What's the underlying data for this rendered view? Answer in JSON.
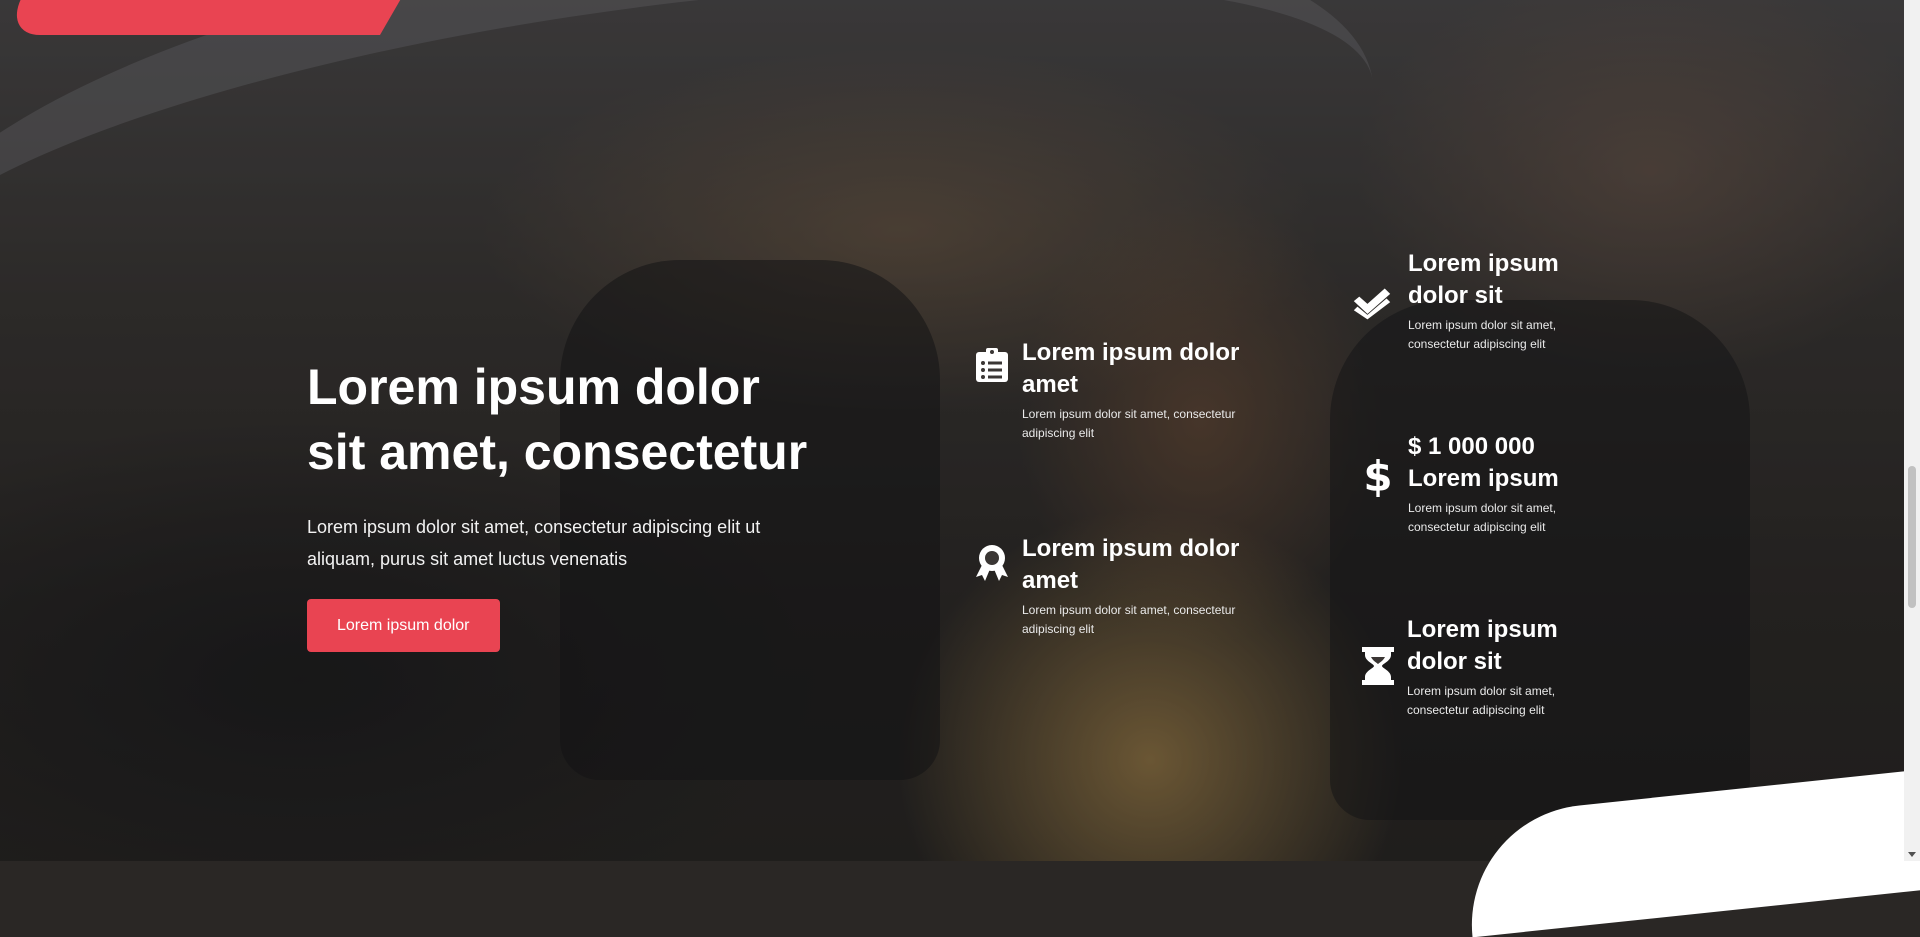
{
  "hero": {
    "title": "Lorem ipsum dolor sit amet, consectetur",
    "subtitle": "Lorem ipsum dolor sit amet, consectetur adipiscing elit ut aliquam, purus sit amet luctus venenatis",
    "cta_label": "Lorem ipsum dolor"
  },
  "features": [
    {
      "icon": "clipboard-list-icon",
      "title": "Lorem ipsum dolor amet",
      "desc": "Lorem ipsum dolor sit amet, consectetur adipiscing elit"
    },
    {
      "icon": "award-icon",
      "title": "Lorem ipsum dolor amet",
      "desc": "Lorem ipsum dolor sit amet, consectetur adipiscing elit"
    },
    {
      "icon": "double-check-icon",
      "title": "Lorem ipsum dolor sit",
      "desc": "Lorem ipsum dolor sit amet, consectetur adipiscing elit"
    },
    {
      "icon": "dollar-icon",
      "title": "$ 1 000 000 Lorem ipsum",
      "desc": "Lorem ipsum dolor sit amet, consectetur adipiscing elit"
    },
    {
      "icon": "hourglass-icon",
      "title": "Lorem ipsum dolor sit",
      "desc": "Lorem ipsum dolor sit amet, consectetur adipiscing elit"
    }
  ],
  "colors": {
    "accent": "#e94452",
    "text": "#ffffff"
  }
}
